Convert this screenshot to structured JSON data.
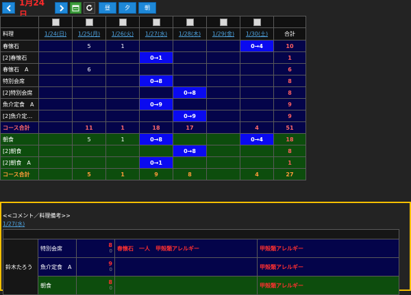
{
  "toolbar": {
    "date_title": "1月24日",
    "prev_icon": "<",
    "next_icon": ">",
    "calendar_icon": "calendar-icon",
    "refresh_icon": "refresh-icon",
    "meal_buttons": [
      "昼",
      "夕",
      "朝"
    ]
  },
  "grid": {
    "header_first": "料理",
    "header_total": "合計",
    "days": [
      "1/24(日)",
      "1/25(月)",
      "1/26(火)",
      "1/27(水)",
      "1/28(木)",
      "1/29(金)",
      "1/30(土)"
    ],
    "rows": [
      {
        "name": "春懐石",
        "cells": [
          "",
          "5",
          "1",
          "",
          "",
          "",
          "0→4"
        ],
        "hl": [
          6
        ],
        "total": "10",
        "group": "navy"
      },
      {
        "name": "[2]春懐石",
        "cells": [
          "",
          "",
          "",
          "0→1",
          "",
          "",
          ""
        ],
        "hl": [
          3
        ],
        "total": "1",
        "group": "navy"
      },
      {
        "name": "春懐石　A",
        "cells": [
          "",
          "6",
          "",
          "",
          "",
          "",
          ""
        ],
        "hl": [],
        "total": "6",
        "group": "navy"
      },
      {
        "name": "特別会席",
        "cells": [
          "",
          "",
          "",
          "0→8",
          "",
          "",
          ""
        ],
        "hl": [
          3
        ],
        "total": "8",
        "group": "navy"
      },
      {
        "name": "[2]特別会席",
        "cells": [
          "",
          "",
          "",
          "",
          "0→8",
          "",
          ""
        ],
        "hl": [
          4
        ],
        "total": "8",
        "group": "navy"
      },
      {
        "name": "魚介定食　A",
        "cells": [
          "",
          "",
          "",
          "0→9",
          "",
          "",
          ""
        ],
        "hl": [
          3
        ],
        "total": "9",
        "group": "navy"
      },
      {
        "name": "[2]魚介定…",
        "cells": [
          "",
          "",
          "",
          "",
          "0→9",
          "",
          ""
        ],
        "hl": [
          4
        ],
        "total": "9",
        "group": "navy"
      },
      {
        "name": "コース合計",
        "cells": [
          "",
          "11",
          "1",
          "18",
          "17",
          "",
          "4"
        ],
        "hl": [],
        "total": "51",
        "group": "navy",
        "sum": true
      },
      {
        "name": "朝食",
        "cells": [
          "",
          "5",
          "1",
          "0→8",
          "",
          "",
          "0→4"
        ],
        "hl": [
          3,
          6
        ],
        "total": "18",
        "group": "green"
      },
      {
        "name": "[2]朝食",
        "cells": [
          "",
          "",
          "",
          "",
          "0→8",
          "",
          ""
        ],
        "hl": [
          4
        ],
        "total": "8",
        "group": "green"
      },
      {
        "name": "[2]朝食　A",
        "cells": [
          "",
          "",
          "",
          "0→1",
          "",
          "",
          ""
        ],
        "hl": [
          3
        ],
        "total": "1",
        "group": "green"
      },
      {
        "name": "コース合計",
        "cells": [
          "",
          "5",
          "1",
          "9",
          "8",
          "",
          "4"
        ],
        "hl": [],
        "total": "27",
        "group": "green",
        "sum": true
      }
    ]
  },
  "comments": {
    "title": "<<コメント／料理備考>>",
    "date": "1/27(水)",
    "guest": "鈴木たろう",
    "rows": [
      {
        "dish": "特別会席",
        "count": "8",
        "count_sub": "0",
        "note": "春懐石　一人　甲殻類アレルギー",
        "note2": "甲殻類アレルギー",
        "group": "navy"
      },
      {
        "dish": "魚介定食　A",
        "count": "9",
        "count_sub": "0",
        "note": "",
        "note2": "甲殻類アレルギー",
        "group": "navy"
      },
      {
        "dish": "朝食",
        "count": "8",
        "count_sub": "0",
        "note": "",
        "note2": "甲殻類アレルギー",
        "group": "green"
      }
    ]
  },
  "colors": {
    "highlight": "#0a0af0",
    "panel_border": "#f6c000",
    "accent": "#1e88d8"
  }
}
